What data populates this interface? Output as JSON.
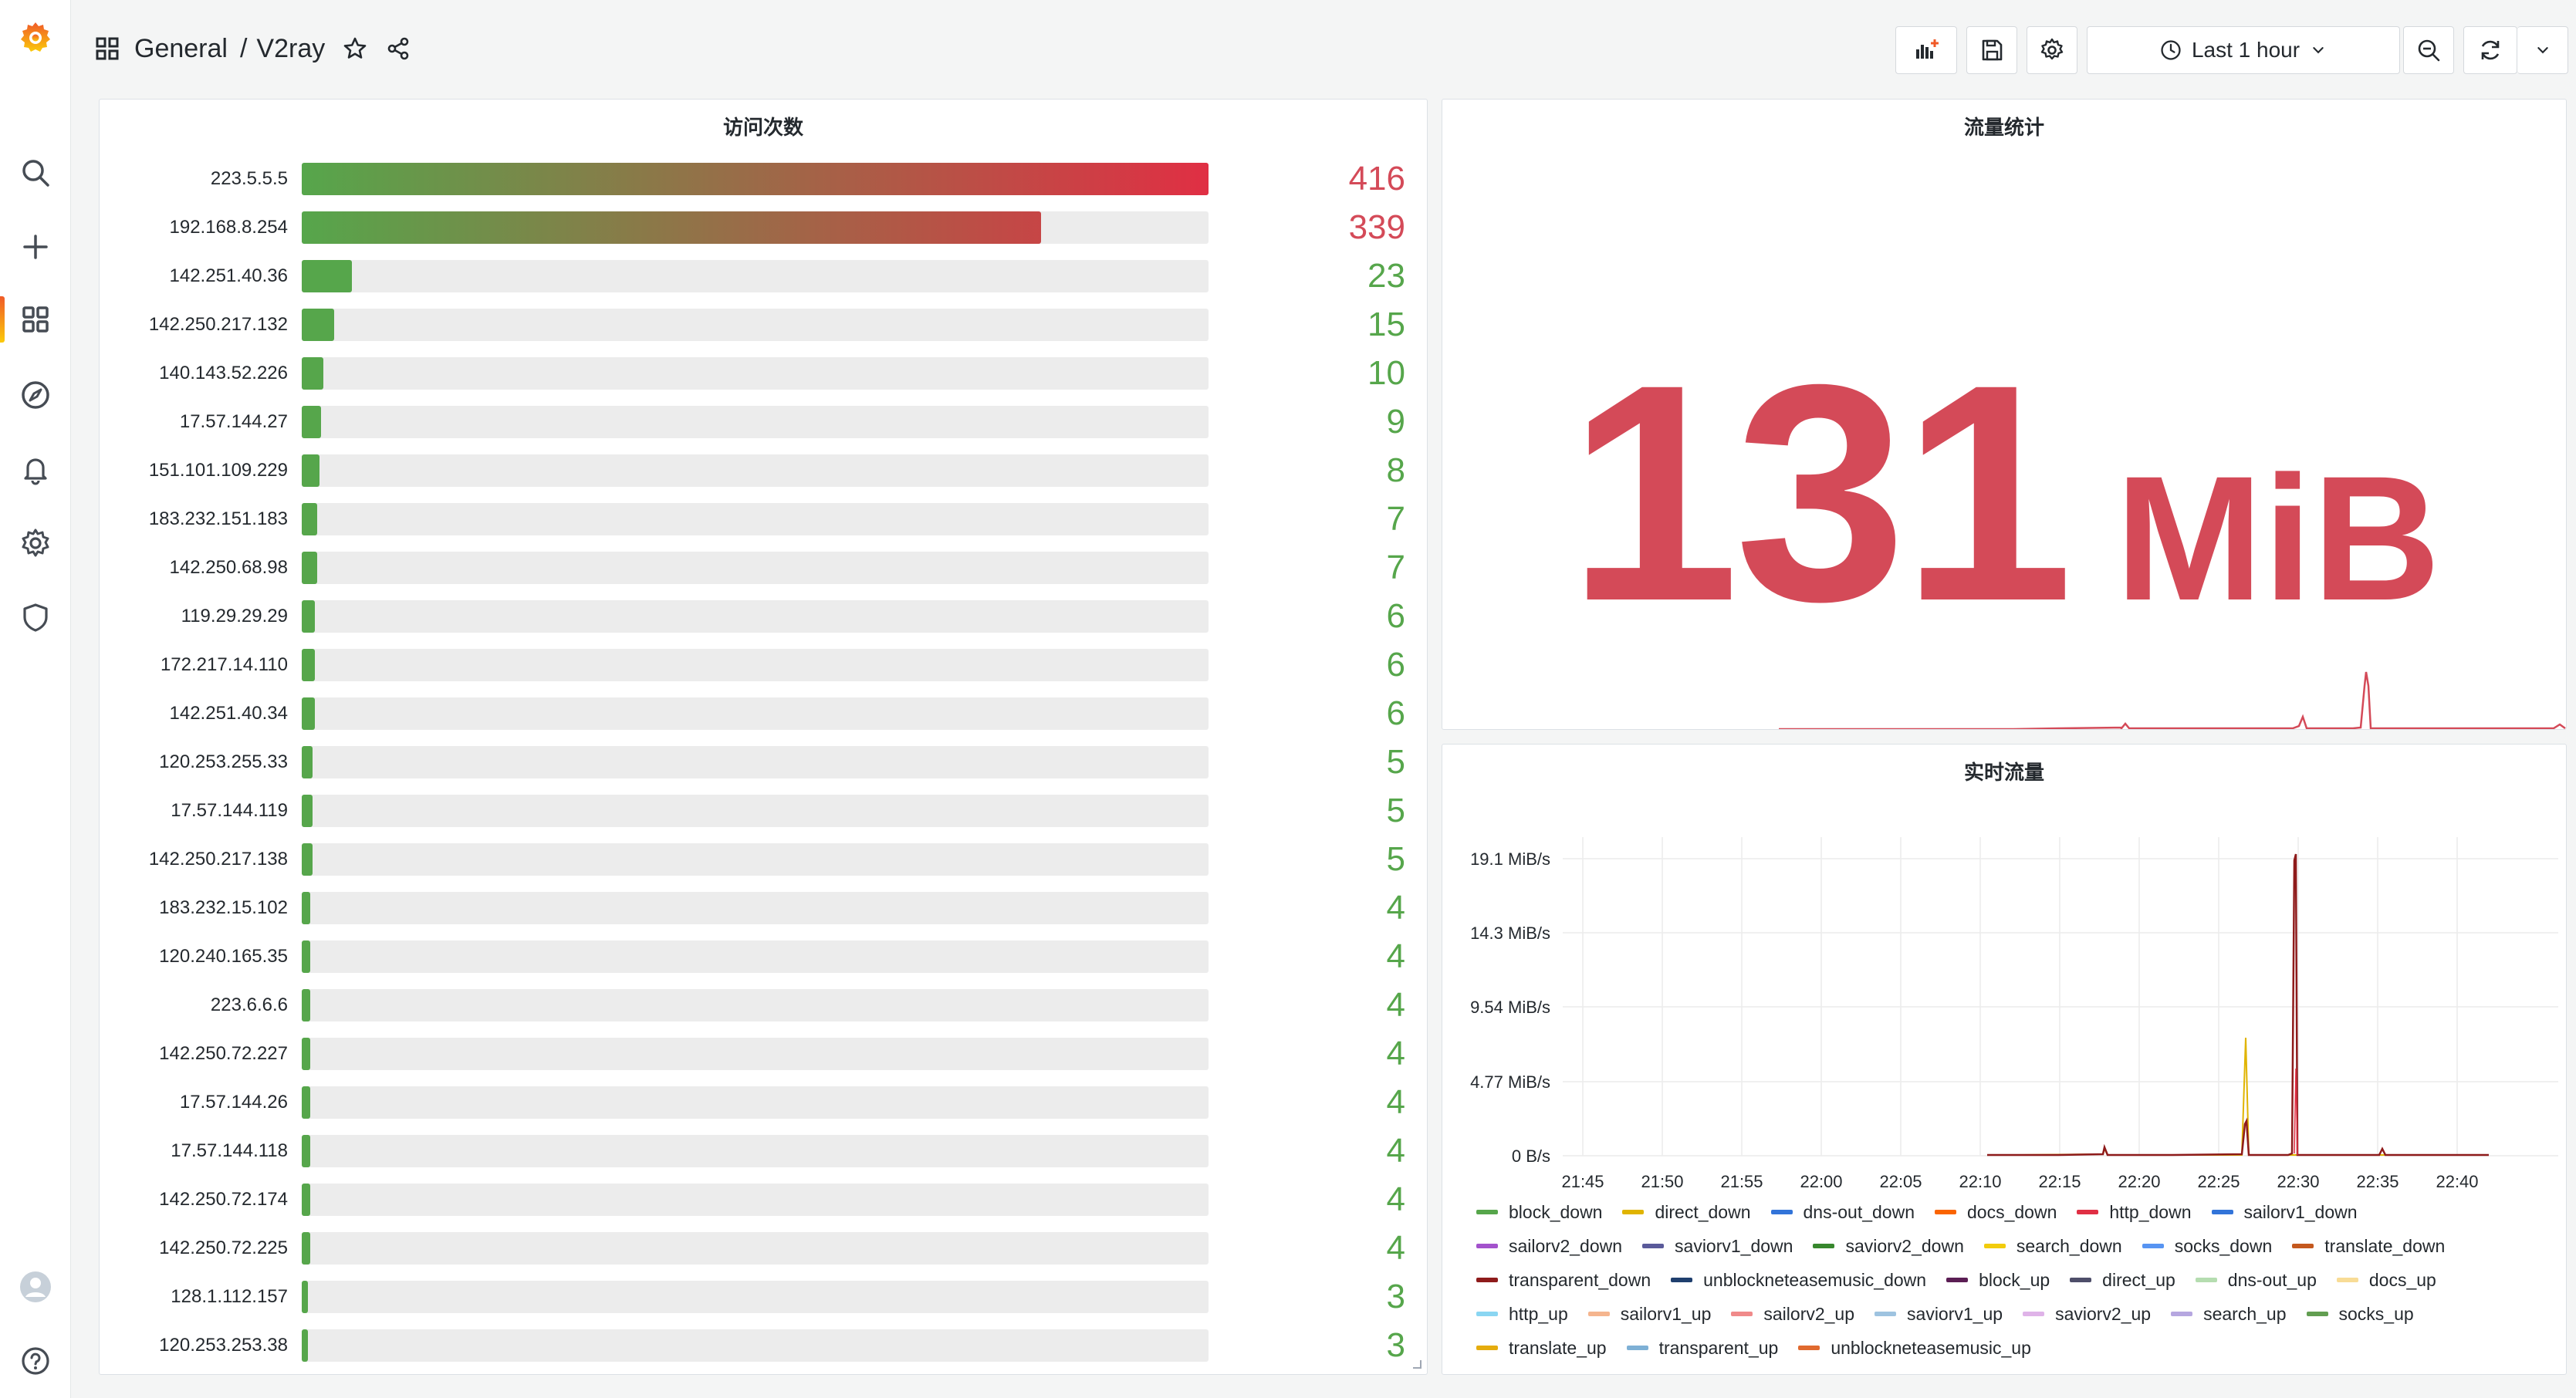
{
  "breadcrumb": {
    "folder": "General",
    "separator": "/",
    "dashboard": "V2ray"
  },
  "toolbar": {
    "time_range": "Last 1 hour"
  },
  "panels": {
    "bargauge": {
      "title": "访问次数",
      "max": 416,
      "rows": [
        {
          "label": "223.5.5.5",
          "value": 416
        },
        {
          "label": "192.168.8.254",
          "value": 339
        },
        {
          "label": "142.251.40.36",
          "value": 23
        },
        {
          "label": "142.250.217.132",
          "value": 15
        },
        {
          "label": "140.143.52.226",
          "value": 10
        },
        {
          "label": "17.57.144.27",
          "value": 9
        },
        {
          "label": "151.101.109.229",
          "value": 8
        },
        {
          "label": "183.232.151.183",
          "value": 7
        },
        {
          "label": "142.250.68.98",
          "value": 7
        },
        {
          "label": "119.29.29.29",
          "value": 6
        },
        {
          "label": "172.217.14.110",
          "value": 6
        },
        {
          "label": "142.251.40.34",
          "value": 6
        },
        {
          "label": "120.253.255.33",
          "value": 5
        },
        {
          "label": "17.57.144.119",
          "value": 5
        },
        {
          "label": "142.250.217.138",
          "value": 5
        },
        {
          "label": "183.232.15.102",
          "value": 4
        },
        {
          "label": "120.240.165.35",
          "value": 4
        },
        {
          "label": "223.6.6.6",
          "value": 4
        },
        {
          "label": "142.250.72.227",
          "value": 4
        },
        {
          "label": "17.57.144.26",
          "value": 4
        },
        {
          "label": "17.57.144.118",
          "value": 4
        },
        {
          "label": "142.250.72.174",
          "value": 4
        },
        {
          "label": "142.250.72.225",
          "value": 4
        },
        {
          "label": "128.1.112.157",
          "value": 3
        },
        {
          "label": "120.253.253.38",
          "value": 3
        }
      ],
      "colors": {
        "green": "#56a64b",
        "red": "#e02f44",
        "value_green": "#56a64b",
        "value_red": "#d44a58"
      }
    },
    "stat": {
      "title": "流量统计",
      "value": "131",
      "unit": "MiB",
      "color": "#d44a58",
      "sparkline_color": "#d44a58"
    },
    "timeseries": {
      "title": "实时流量",
      "y_ticks": [
        "19.1 MiB/s",
        "14.3 MiB/s",
        "9.54 MiB/s",
        "4.77 MiB/s",
        "0 B/s"
      ],
      "x_ticks": [
        "21:45",
        "21:50",
        "21:55",
        "22:00",
        "22:05",
        "22:10",
        "22:15",
        "22:20",
        "22:25",
        "22:30",
        "22:35",
        "22:40"
      ],
      "legend": [
        {
          "name": "block_down",
          "color": "#56a64b"
        },
        {
          "name": "direct_down",
          "color": "#e0b400"
        },
        {
          "name": "dns-out_down",
          "color": "#3274d9"
        },
        {
          "name": "docs_down",
          "color": "#fa6400"
        },
        {
          "name": "http_down",
          "color": "#e02f44"
        },
        {
          "name": "sailorv1_down",
          "color": "#3274d9"
        },
        {
          "name": "sailorv2_down",
          "color": "#a352cc"
        },
        {
          "name": "saviorv1_down",
          "color": "#5a5a9a"
        },
        {
          "name": "saviorv2_down",
          "color": "#37872d"
        },
        {
          "name": "search_down",
          "color": "#f2cc0c"
        },
        {
          "name": "socks_down",
          "color": "#5794f2"
        },
        {
          "name": "translate_down",
          "color": "#c4581e"
        },
        {
          "name": "transparent_down",
          "color": "#8e1b1b"
        },
        {
          "name": "unblockneteasemusic_down",
          "color": "#1f3f6e"
        },
        {
          "name": "block_up",
          "color": "#5b1e54"
        },
        {
          "name": "direct_up",
          "color": "#4e4e6a"
        },
        {
          "name": "dns-out_up",
          "color": "#b5ddb0"
        },
        {
          "name": "docs_up",
          "color": "#f8dc96"
        },
        {
          "name": "http_up",
          "color": "#8ad6f2"
        },
        {
          "name": "sailorv1_up",
          "color": "#f5b58e"
        },
        {
          "name": "sailorv2_up",
          "color": "#f08a8a"
        },
        {
          "name": "saviorv1_up",
          "color": "#9ec3e0"
        },
        {
          "name": "saviorv2_up",
          "color": "#dfb3e8"
        },
        {
          "name": "search_up",
          "color": "#b6a7e0"
        },
        {
          "name": "socks_up",
          "color": "#629e51"
        },
        {
          "name": "translate_up",
          "color": "#e5ac0e"
        },
        {
          "name": "transparent_up",
          "color": "#7eb0d5"
        },
        {
          "name": "unblockneteasemusic_up",
          "color": "#e06a2f"
        }
      ]
    }
  }
}
